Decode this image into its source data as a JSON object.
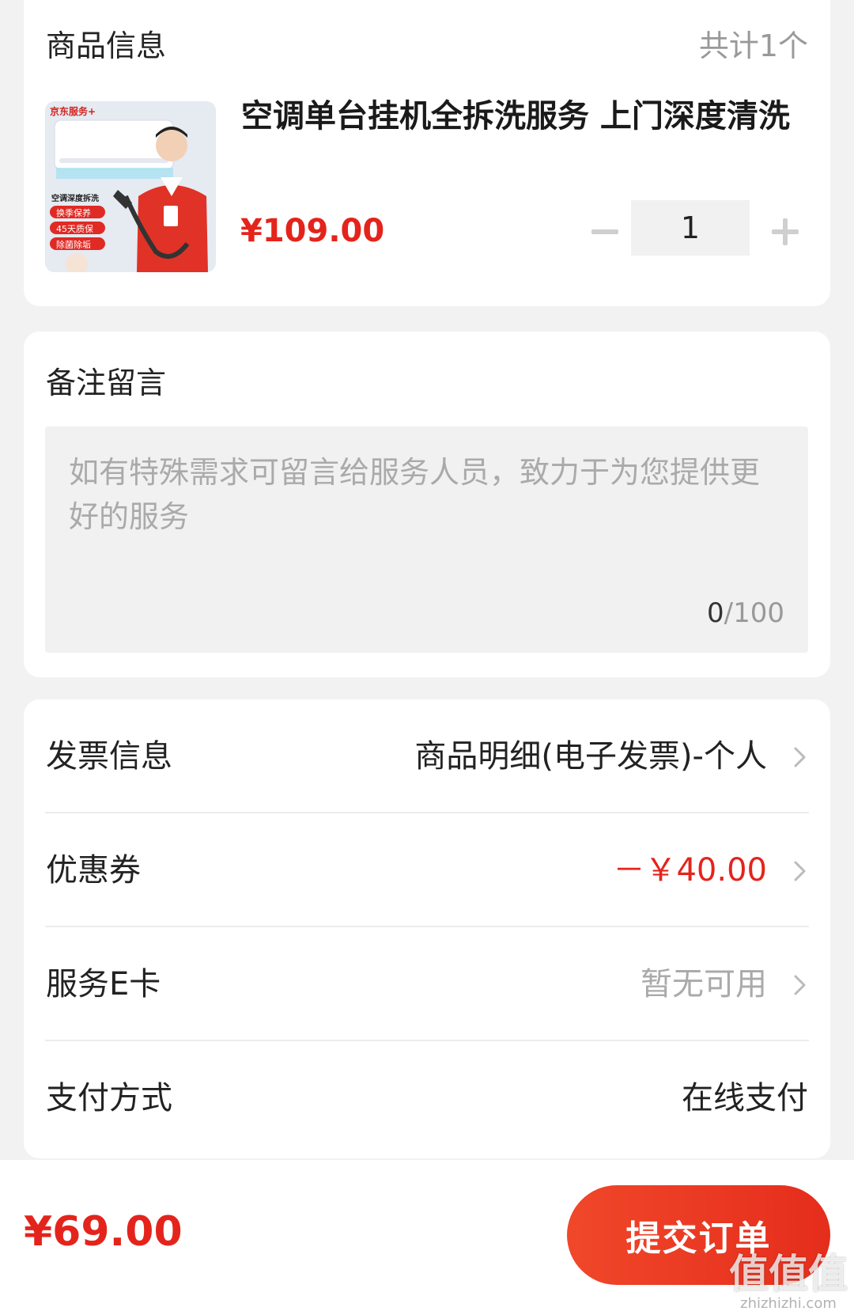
{
  "product": {
    "section_title": "商品信息",
    "count_text": "共计1个",
    "name": "空调单台挂机全拆洗服务 上门深度清洗",
    "price": "¥109.00",
    "quantity": "1",
    "thumb": {
      "brand_text": "京东服务+",
      "caption": "空调深度拆洗",
      "tags": [
        "换季保养",
        "45天质保",
        "除菌除垢"
      ]
    }
  },
  "remark": {
    "section_title": "备注留言",
    "placeholder": "如有特殊需求可留言给服务人员，致力于为您提供更好的服务",
    "counter_current": "0",
    "counter_max": "/100"
  },
  "options": {
    "invoice": {
      "label": "发票信息",
      "value": "商品明细(电子发票)-个人"
    },
    "coupon": {
      "label": "优惠券",
      "value": "－￥40.00"
    },
    "ecard": {
      "label": "服务E卡",
      "value": "暂无可用"
    },
    "payment": {
      "label": "支付方式",
      "value": "在线支付"
    }
  },
  "footer": {
    "total": "¥69.00",
    "submit_label": "提交订单"
  },
  "watermark": {
    "mark": "值值值",
    "domain": "zhizhizhi.com"
  },
  "colors": {
    "accent_red": "#e4241c",
    "button_gradient_start": "#f0472a",
    "button_gradient_end": "#e52d1c",
    "page_bg": "#f2f2f2"
  }
}
